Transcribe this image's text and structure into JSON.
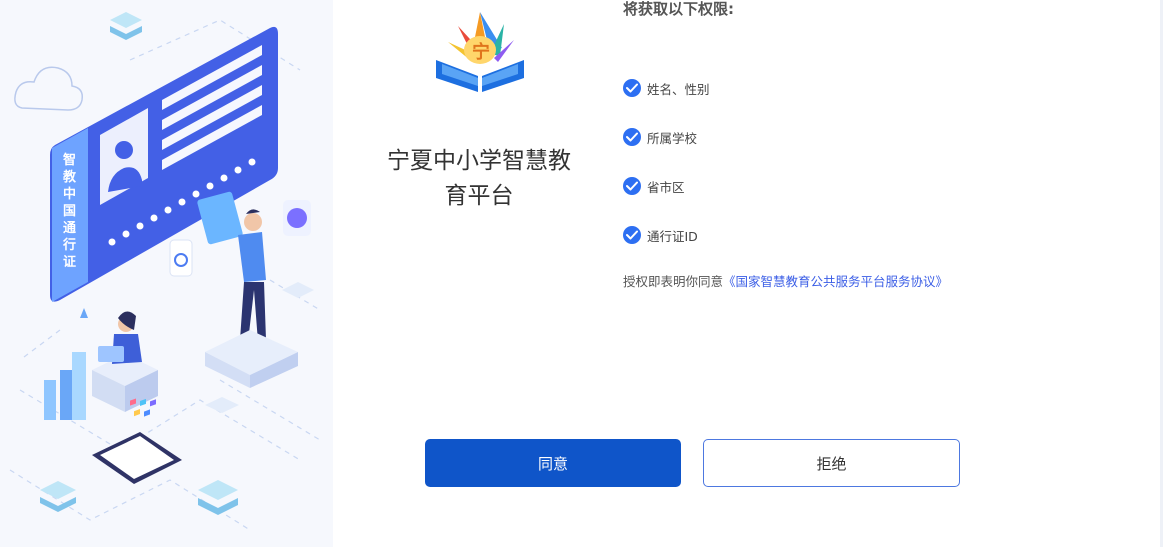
{
  "illustration": {
    "card_text": "智教中国通行证",
    "icon_names": [
      "id-card-illustration",
      "cloud-icon",
      "phone-illustration",
      "person-illustration"
    ]
  },
  "app": {
    "logo_icon": "book-logo-icon",
    "name_line1": "宁夏中小学智慧教",
    "name_line2": "育平台"
  },
  "permissions": {
    "title": "将获取以下权限:",
    "items": [
      {
        "label": "姓名、性别",
        "icon": "check-circle-icon"
      },
      {
        "label": "所属学校",
        "icon": "check-circle-icon"
      },
      {
        "label": "省市区",
        "icon": "check-circle-icon"
      },
      {
        "label": "通行证ID",
        "icon": "check-circle-icon"
      }
    ]
  },
  "consent": {
    "prefix": "授权即表明你同意",
    "link": "《国家智慧教育公共服务平台服务协议》"
  },
  "buttons": {
    "agree": "同意",
    "reject": "拒绝"
  },
  "colors": {
    "primary": "#0f55c9",
    "check": "#2d6ff2",
    "link": "#3b5ee6",
    "card": "#4d63e6"
  }
}
